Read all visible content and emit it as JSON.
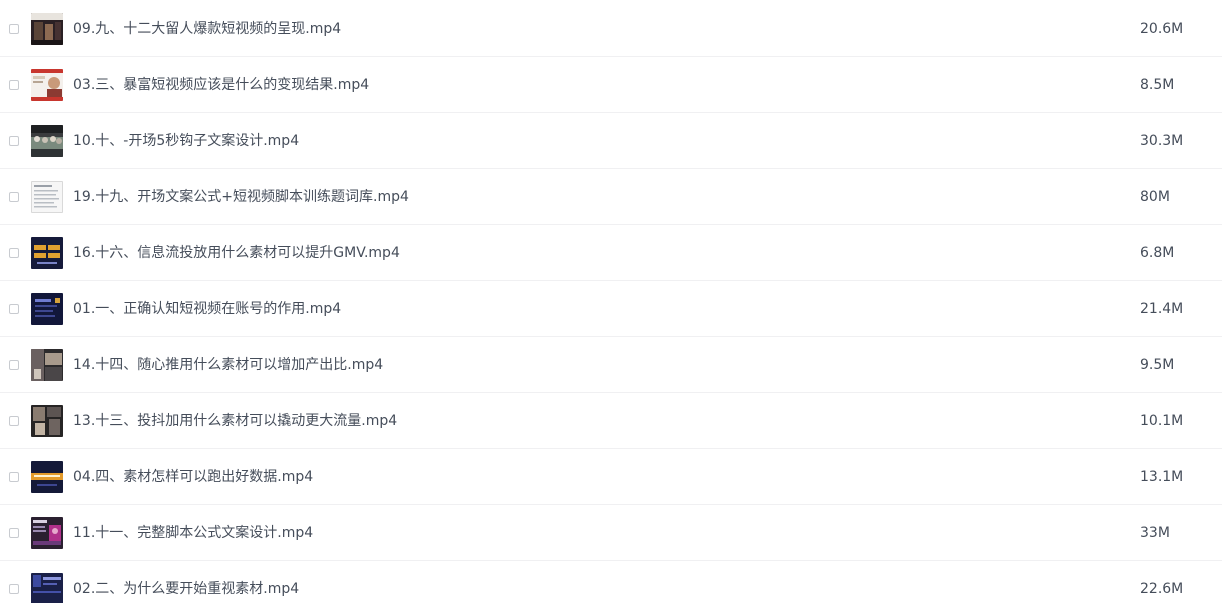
{
  "files": [
    {
      "name": "09.九、十二大留人爆款短视频的呈现.mp4",
      "size": "20.6M",
      "thumb": "thumb-dark-room"
    },
    {
      "name": "03.三、暴富短视频应该是什么的变现结果.mp4",
      "size": "8.5M",
      "thumb": "thumb-speaker"
    },
    {
      "name": "10.十、-开场5秒钩子文案设计.mp4",
      "size": "30.3M",
      "thumb": "thumb-crowd"
    },
    {
      "name": "19.十九、开场文案公式+短视频脚本训练题词库.mp4",
      "size": "80M",
      "thumb": "thumb-document"
    },
    {
      "name": "16.十六、信息流投放用什么素材可以提升GMV.mp4",
      "size": "6.8M",
      "thumb": "thumb-dark-slide"
    },
    {
      "name": "01.一、正确认知短视频在账号的作用.mp4",
      "size": "21.4M",
      "thumb": "thumb-dark-slide"
    },
    {
      "name": "14.十四、随心推用什么素材可以增加产出比.mp4",
      "size": "9.5M",
      "thumb": "thumb-street"
    },
    {
      "name": "13.十三、投抖加用什么素材可以撬动更大流量.mp4",
      "size": "10.1M",
      "thumb": "thumb-street"
    },
    {
      "name": "04.四、素材怎样可以跑出好数据.mp4",
      "size": "13.1M",
      "thumb": "thumb-banner"
    },
    {
      "name": "11.十一、完整脚本公式文案设计.mp4",
      "size": "33M",
      "thumb": "thumb-purple"
    },
    {
      "name": "02.二、为什么要开始重视素材.mp4",
      "size": "22.6M",
      "thumb": "thumb-dark-slide"
    }
  ]
}
